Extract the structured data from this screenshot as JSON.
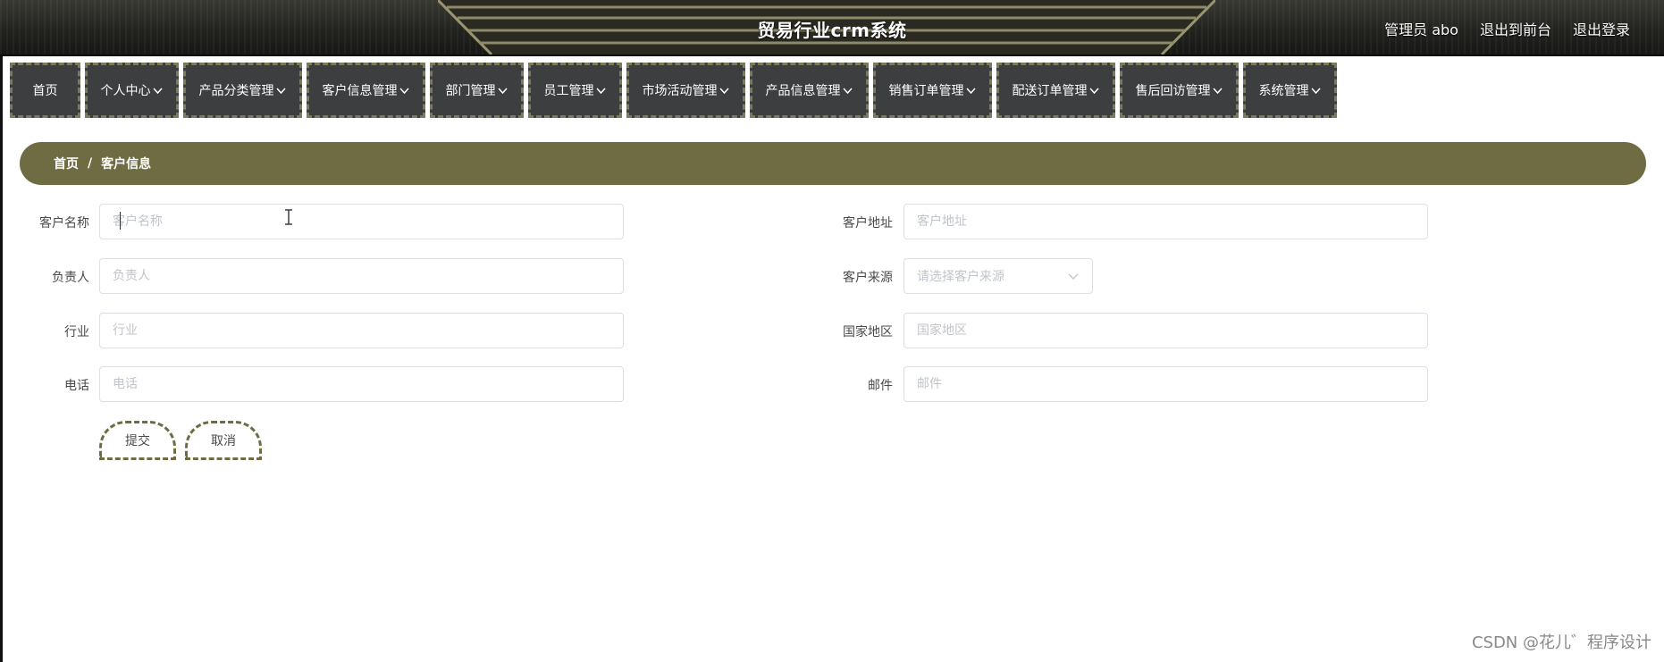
{
  "header": {
    "title": "贸易行业crm系统",
    "admin_label": "管理员 abo",
    "front_link": "退出到前台",
    "logout_link": "退出登录"
  },
  "nav": {
    "items": [
      {
        "label": "首页",
        "dropdown": false
      },
      {
        "label": "个人中心",
        "dropdown": true
      },
      {
        "label": "产品分类管理",
        "dropdown": true
      },
      {
        "label": "客户信息管理",
        "dropdown": true
      },
      {
        "label": "部门管理",
        "dropdown": true
      },
      {
        "label": "员工管理",
        "dropdown": true
      },
      {
        "label": "市场活动管理",
        "dropdown": true
      },
      {
        "label": "产品信息管理",
        "dropdown": true
      },
      {
        "label": "销售订单管理",
        "dropdown": true
      },
      {
        "label": "配送订单管理",
        "dropdown": true
      },
      {
        "label": "售后回访管理",
        "dropdown": true
      },
      {
        "label": "系统管理",
        "dropdown": true
      }
    ]
  },
  "breadcrumb": {
    "home": "首页",
    "separator": "/",
    "current": "客户信息"
  },
  "form": {
    "customer_name": {
      "label": "客户名称",
      "placeholder": "客户名称",
      "value": ""
    },
    "owner": {
      "label": "负责人",
      "placeholder": "负责人",
      "value": ""
    },
    "industry": {
      "label": "行业",
      "placeholder": "行业",
      "value": ""
    },
    "phone": {
      "label": "电话",
      "placeholder": "电话",
      "value": ""
    },
    "address": {
      "label": "客户地址",
      "placeholder": "客户地址",
      "value": ""
    },
    "source": {
      "label": "客户来源",
      "placeholder": "请选择客户来源"
    },
    "region": {
      "label": "国家地区",
      "placeholder": "国家地区",
      "value": ""
    },
    "email": {
      "label": "邮件",
      "placeholder": "邮件",
      "value": ""
    }
  },
  "buttons": {
    "submit": "提交",
    "cancel": "取消"
  },
  "watermark": "CSDN @花儿゛程序设计",
  "colors": {
    "accent": "#6f6c44",
    "nav_bg": "#3d3e40",
    "nav_border": "#7b7b5a",
    "header_bg": "#22221f"
  }
}
